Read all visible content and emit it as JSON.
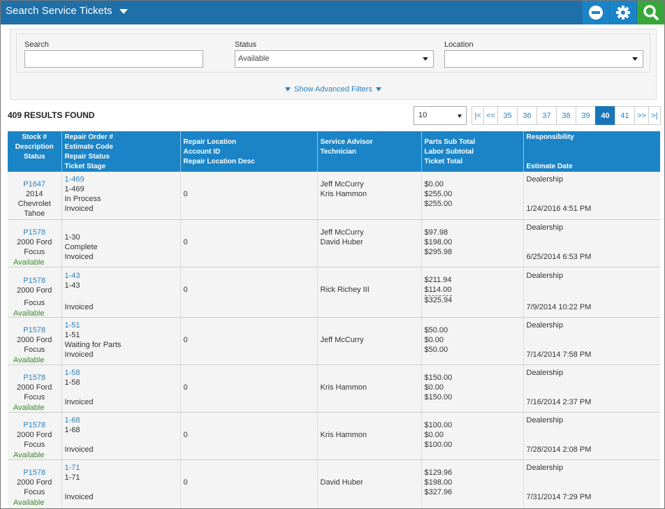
{
  "header": {
    "title": "Search Service Tickets"
  },
  "filters": {
    "search_label": "Search",
    "search_value": "",
    "status_label": "Status",
    "status_value": "Available",
    "location_label": "Location",
    "location_value": "",
    "advanced_label": "Show Advanced Filters"
  },
  "results": {
    "count_text": "409 RESULTS FOUND",
    "page_size": "10"
  },
  "pager": {
    "first": "|<",
    "prev": "<<",
    "pages": [
      "35",
      "36",
      "37",
      "38",
      "39",
      "40",
      "41"
    ],
    "active_page": "40",
    "next": ">>",
    "last": ">|"
  },
  "table": {
    "headers": [
      [
        "Stock #",
        "Description",
        "Status"
      ],
      [
        "Repair Order #",
        "Estimate Code",
        "Repair Status",
        "Ticket Stage"
      ],
      [
        "Repair Location",
        "Account ID",
        "Repair Location Desc"
      ],
      [
        "Service Advisor",
        "Technician"
      ],
      [
        "Parts Sub Total",
        "Labor Subtotal",
        "Ticket Total"
      ],
      [
        "Responsibility",
        "Estimate Date"
      ]
    ],
    "rows": [
      {
        "stock": "P1647",
        "desc": [
          "2014",
          "Chevrolet",
          "Tahoe"
        ],
        "status": "",
        "ro": "1-469",
        "estimate_code": "1-469",
        "repair_status": "In Process",
        "stage": "Invoiced",
        "account_id": "0",
        "advisor": "Jeff McCurry",
        "technician": "Kris Hammon",
        "parts": "$0.00",
        "labor": "$255.00",
        "total": "$255.00",
        "responsibility": "Dealership",
        "date": "1/24/2016 4:51 PM"
      },
      {
        "stock": "P1578",
        "desc": [
          "2000 Ford",
          "Focus"
        ],
        "status": "Available",
        "ro": "",
        "estimate_code": "1-30",
        "repair_status": "Complete",
        "stage": "Invoiced",
        "account_id": "0",
        "advisor": "Jeff McCurry",
        "technician": "David Huber",
        "parts": "$97.98",
        "labor": "$198.00",
        "total": "$295.98",
        "responsibility": "Dealership",
        "date": "6/25/2014 6:53 PM"
      },
      {
        "stock": "P1578",
        "desc": [
          "2000 Ford",
          "",
          "Focus"
        ],
        "status": "Available",
        "ro": "1-43",
        "estimate_code": "1-43",
        "repair_status": "",
        "stage": "Invoiced",
        "account_id": "0",
        "advisor": "Rick Richey III",
        "technician": "",
        "parts": "$211.94",
        "labor": "$114.00",
        "total": "$325.94",
        "responsibility": "Dealership",
        "date": "7/9/2014 10:22 PM"
      },
      {
        "stock": "P1578",
        "desc": [
          "2000 Ford",
          "Focus"
        ],
        "status": "Available",
        "ro": "1-51",
        "estimate_code": "1-51",
        "repair_status": "Waiting for Parts",
        "stage": "Invoiced",
        "account_id": "0",
        "advisor": "Jeff McCurry",
        "technician": "",
        "parts": "$50.00",
        "labor": "$0.00",
        "total": "$50.00",
        "responsibility": "Dealership",
        "date": "7/14/2014 7:58 PM"
      },
      {
        "stock": "P1578",
        "desc": [
          "2000 Ford",
          "Focus"
        ],
        "status": "Available",
        "ro": "1-58",
        "estimate_code": "1-58",
        "repair_status": "",
        "stage": "Invoiced",
        "account_id": "0",
        "advisor": "",
        "technician": "Kris Hammon",
        "parts": "$150.00",
        "labor": "$0.00",
        "total": "$150.00",
        "responsibility": "Dealership",
        "date": "7/16/2014 2:37 PM"
      },
      {
        "stock": "P1578",
        "desc": [
          "2000 Ford",
          "Focus"
        ],
        "status": "Available",
        "ro": "1-68",
        "estimate_code": "1-68",
        "repair_status": "",
        "stage": "Invoiced",
        "account_id": "0",
        "advisor": "",
        "technician": "Kris Hammon",
        "parts": "$100.00",
        "labor": "$0.00",
        "total": "$100.00",
        "responsibility": "Dealership",
        "date": "7/28/2014 2:08 PM"
      },
      {
        "stock": "P1578",
        "desc": [
          "2000 Ford",
          "Focus"
        ],
        "status": "Available",
        "ro": "1-71",
        "estimate_code": "1-71",
        "repair_status": "",
        "stage": "Invoiced",
        "account_id": "0",
        "advisor": "",
        "technician": "David Huber",
        "parts": "$129.96",
        "labor": "$198.00",
        "total": "$327.96",
        "responsibility": "Dealership",
        "date": "7/31/2014 7:29 PM"
      }
    ]
  }
}
